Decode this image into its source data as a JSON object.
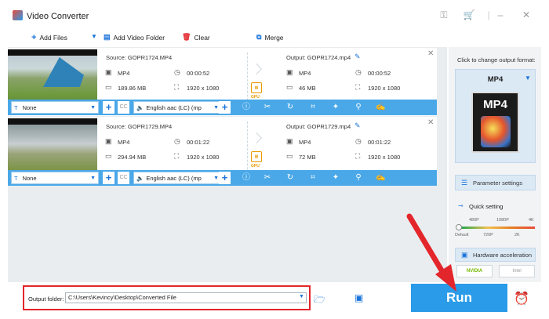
{
  "app": {
    "title": "Video Converter"
  },
  "toolbar": {
    "add_files": "Add Files",
    "add_video_folder": "Add Video Folder",
    "clear": "Clear",
    "merge": "Merge"
  },
  "items": [
    {
      "source": "Source: GOPR1724.MP4",
      "src_format": "MP4",
      "src_duration": "00:00:52",
      "src_size": "189.86 MB",
      "src_resolution": "1920 x 1080",
      "output": "Output: GOPR1724.mp4",
      "out_format": "MP4",
      "out_duration": "00:00:52",
      "out_size": "46 MB",
      "out_resolution": "1920 x 1080",
      "subtitle": "None",
      "audio": "English aac (LC) (mp",
      "gpu": "GPU"
    },
    {
      "source": "Source: GOPR1729.MP4",
      "src_format": "MP4",
      "src_duration": "00:01:22",
      "src_size": "294.94 MB",
      "src_resolution": "1920 x 1080",
      "output": "Output: GOPR1729.mp4",
      "out_format": "MP4",
      "out_duration": "00:01:22",
      "out_size": "72 MB",
      "out_resolution": "1920 x 1080",
      "subtitle": "None",
      "audio": "English aac (LC) (mp",
      "gpu": "GPU"
    }
  ],
  "right_panel": {
    "click_label": "Click to change output format:",
    "format": "MP4",
    "format_icon_label": "MP4",
    "parameter_settings": "Parameter settings",
    "quick_setting": "Quick setting",
    "slider_top_labels": [
      "480P",
      "1080P",
      "4K"
    ],
    "slider_bottom_labels": [
      "Default",
      "720P",
      "2K"
    ],
    "slider_level": 0,
    "hardware_acceleration": "Hardware acceleration",
    "nvidia": "NVIDIA",
    "intel": "Intel"
  },
  "bottom": {
    "output_folder_label": "Output folder:",
    "output_folder_value": "C:\\Users\\Kevincy\\Desktop\\Converted File",
    "run": "Run"
  },
  "colors": {
    "accent": "#2a9be8",
    "highlight": "#e3262b",
    "gpu": "#e89900"
  }
}
